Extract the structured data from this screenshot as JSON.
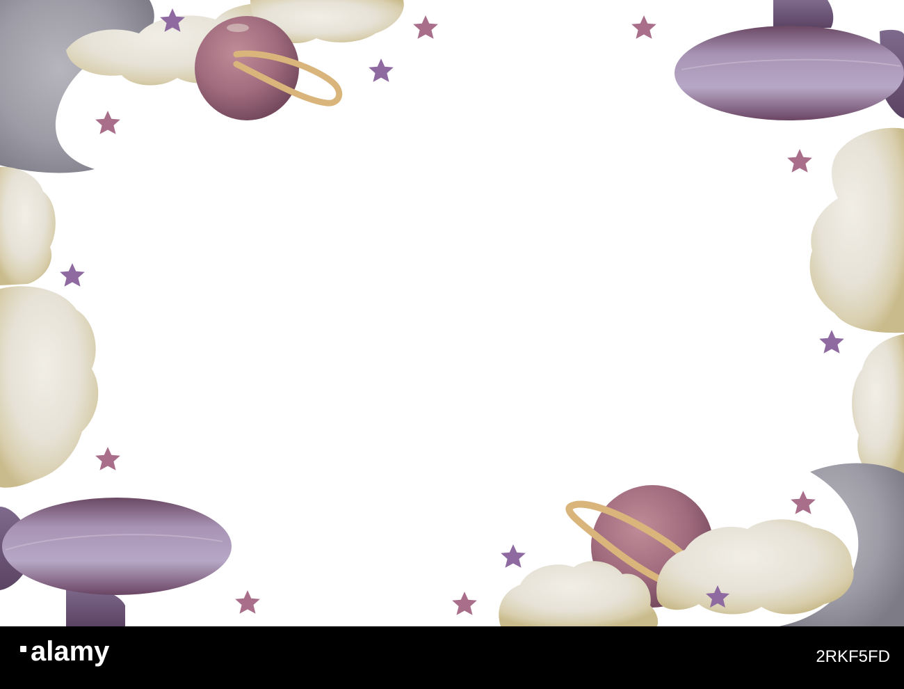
{
  "artwork": {
    "palette": {
      "cloud": "#e9e4d6",
      "cloud_shadow": "#b8b2a8",
      "cloud_ochre": "#d8c592",
      "moon": "#a3a2ab",
      "moon_dark": "#7f7e89",
      "airship": "#9a80a6",
      "airship_dark": "#5e3a59",
      "planet": "#b27a8a",
      "planet_dark": "#6e4558",
      "ring": "#d6b27a",
      "star_violet": "#8e6aa0",
      "star_pink": "#a86e8a"
    },
    "elements": [
      "moon",
      "moon",
      "cloud",
      "cloud",
      "cloud",
      "cloud",
      "planet",
      "planet",
      "airship",
      "airship",
      "star"
    ]
  },
  "footer": {
    "brand": "alamy",
    "image_id": "2RKF5FD",
    "background": "#000000"
  }
}
